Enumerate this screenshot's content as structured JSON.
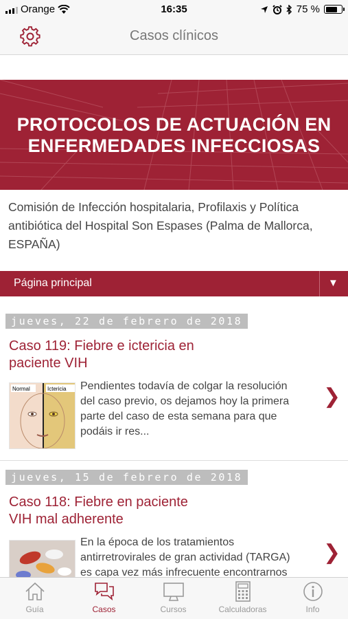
{
  "status_bar": {
    "carrier": "Orange",
    "time": "16:35",
    "battery": "75 %",
    "battery_level": 0.75
  },
  "nav": {
    "title": "Casos clínicos",
    "settings_icon": "gear-icon"
  },
  "banner": {
    "line1": "PROTOCOLOS DE ACTUACIÓN EN",
    "line2": "ENFERMEDADES INFECCIOSAS"
  },
  "subtitle": "Comisión de Infección hospitalaria, Profilaxis y Política antibiótica del Hospital Son Espases (Palma de Mallorca, ESPAÑA)",
  "dropdown": {
    "selected": "Página principal",
    "arrow": "▼"
  },
  "posts": [
    {
      "date": "jueves, 22 de febrero de 2018",
      "title_line1": "Caso 119: Fiebre e ictericia en",
      "title_line2": "paciente VIH",
      "thumb_labels": {
        "left": "Normal",
        "right": "Ictericia"
      },
      "excerpt_lines": [
        "Pendientes todavía de colgar la resolución",
        "del caso previo, os dejamos hoy la primera",
        "parte del caso de esta semana para que",
        "podáis ir res..."
      ],
      "chevron": "❯"
    },
    {
      "date": "jueves, 15 de febrero de 2018",
      "title_line1": "Caso 118: Fiebre en paciente",
      "title_line2": "VIH mal adherente",
      "excerpt_lines": [
        "En la época de los tratamientos",
        "antirretrovirales de gran actividad (TARGA)",
        "es capa vez más infrecuente encontrarnos"
      ],
      "chevron": "❯"
    }
  ],
  "tabs": [
    {
      "label": "Guía",
      "icon": "house-icon",
      "active": false
    },
    {
      "label": "Casos",
      "icon": "chat-bubbles-icon",
      "active": true
    },
    {
      "label": "Cursos",
      "icon": "monitor-icon",
      "active": false
    },
    {
      "label": "Calculadoras",
      "icon": "calculator-icon",
      "active": false
    },
    {
      "label": "Info",
      "icon": "info-icon",
      "active": false
    }
  ],
  "colors": {
    "brand": "#9e2235",
    "date_bar": "#bdbdbd",
    "tab_inactive": "#999999"
  }
}
